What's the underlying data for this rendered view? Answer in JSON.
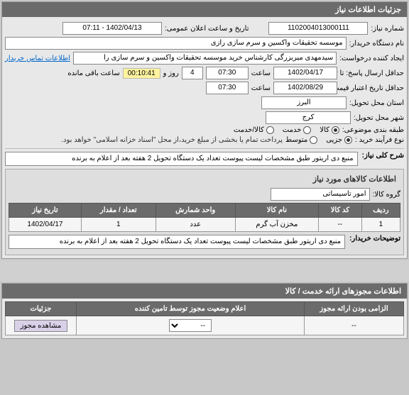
{
  "panel1": {
    "title": "جزئیات اطلاعات نیاز",
    "fields": {
      "need_no_label": "شماره نیاز:",
      "need_no": "1102004013000111",
      "public_date_label": "تاریخ و ساعت اعلان عمومی:",
      "public_date": "1402/04/13 - 07:11",
      "buyer_label": "نام دستگاه خریدار:",
      "buyer": "موسسه تحقیقات واکسین و سرم سازی رازی",
      "creator_label": "ایجاد کننده درخواست:",
      "creator": "سیدمهدی میربزرگی کارشناس خرید موسسه تحقیقات واکسین و سرم سازی را",
      "contact_link": "اطلاعات تماس خریدار",
      "deadline_label": "حداقل ارسال پاسخ: تا تاریخ:",
      "deadline_date": "1402/04/17",
      "time_label": "ساعت",
      "deadline_time": "07:30",
      "day_num": "4",
      "day_label": "روز و",
      "timer": "00:10:41",
      "remain_label": "ساعت باقی مانده",
      "validity_label": "حداقل تاریخ اعتبار قیمت: تا تاریخ:",
      "validity_date": "1402/08/29",
      "validity_time": "07:30",
      "province_label": "استان محل تحویل:",
      "province": "البرز",
      "city_label": "شهر محل تحویل:",
      "city": "کرج",
      "category_label": "طبقه بندی موضوعی:",
      "cat_goods": "کالا",
      "cat_service": "خدمت",
      "cat_both": "کالا/خدمت",
      "process_label": "نوع فرآیند خرید :",
      "process_minor": "جزیی",
      "process_medium": "متوسط",
      "process_note": "پرداخت تمام یا بخشی از مبلغ خرید،از محل \"اسناد خزانه اسلامی\" خواهد بود."
    }
  },
  "desc": {
    "title": "شرح کلی نیاز:",
    "text": "منبع دی اریتور طبق مشخصات لیست پیوست تعداد یک دستگاه تحویل 2 هفته بعد از اعلام به برنده"
  },
  "goods": {
    "header": "اطلاعات کالاهای مورد نیاز",
    "group_label": "گروه کالا:",
    "group_value": "امور تاسیساتی",
    "columns": {
      "row": "ردیف",
      "code": "کد کالا",
      "name": "نام کالا",
      "unit": "واحد شمارش",
      "qty": "تعداد / مقدار",
      "date": "تاریخ نیاز"
    },
    "rows": [
      {
        "row": "1",
        "code": "--",
        "name": "مخزن آب گرم",
        "unit": "عدد",
        "qty": "1",
        "date": "1402/04/17"
      }
    ],
    "buyer_desc_label": "توضیحات خریدار:",
    "buyer_desc": "منبع دی اریتور طبق مشخصات لیست پیوست تعداد یک دستگاه تحویل 2 هفته بعد از اعلام به برنده"
  },
  "permits": {
    "title": "اطلاعات مجوزهای ارائه خدمت / کالا",
    "columns": {
      "mandatory": "الزامی بودن ارائه مجوز",
      "status": "اعلام وضعیت مجوز توسط تامین کننده",
      "details": "جزئیات"
    },
    "row": {
      "mandatory": "--",
      "status": "--",
      "btn": "مشاهده مجوز"
    }
  }
}
